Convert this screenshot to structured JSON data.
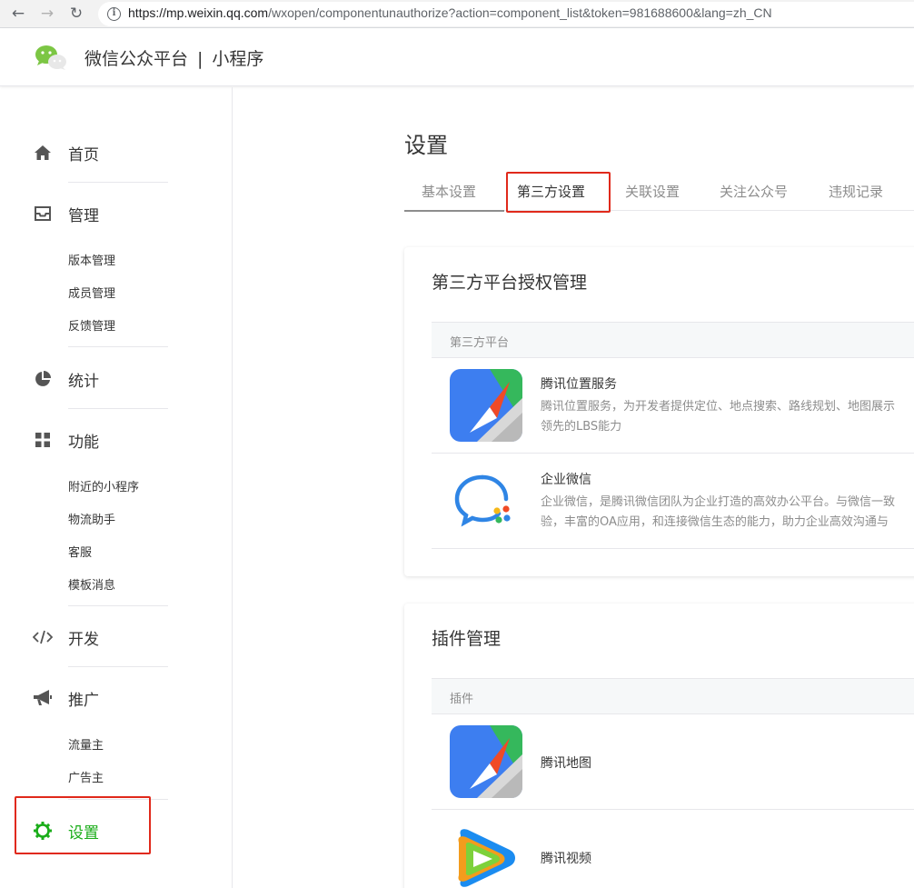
{
  "browser": {
    "url_host": "https://mp.weixin.qq.com",
    "url_rest": "/wxopen/componentunauthorize?action=component_list&token=981688600&lang=zh_CN"
  },
  "header": {
    "brand": "微信公众平台",
    "separator": "|",
    "product": "小程序"
  },
  "sidebar": {
    "home": "首页",
    "manage": "管理",
    "manage_items": [
      "版本管理",
      "成员管理",
      "反馈管理"
    ],
    "stats": "统计",
    "features": "功能",
    "feature_items": [
      "附近的小程序",
      "物流助手",
      "客服",
      "模板消息"
    ],
    "develop": "开发",
    "promote": "推广",
    "promote_items": [
      "流量主",
      "广告主"
    ],
    "settings": "设置"
  },
  "main": {
    "title": "设置",
    "tabs": [
      "基本设置",
      "第三方设置",
      "关联设置",
      "关注公众号",
      "违规记录"
    ],
    "active_tab": "第三方设置"
  },
  "third_party": {
    "title": "第三方平台授权管理",
    "column": "第三方平台",
    "rows": [
      {
        "name": "腾讯位置服务",
        "desc_line1": "腾讯位置服务，为开发者提供定位、地点搜索、路线规划、地图展示",
        "desc_line2": "领先的LBS能力"
      },
      {
        "name": "企业微信",
        "desc_line1": "企业微信，是腾讯微信团队为企业打造的高效办公平台。与微信一致",
        "desc_line2": "验，丰富的OA应用，和连接微信生态的能力，助力企业高效沟通与"
      }
    ]
  },
  "plugins": {
    "title": "插件管理",
    "column": "插件",
    "rows": [
      {
        "name": "腾讯地图"
      },
      {
        "name": "腾讯视频"
      }
    ]
  },
  "colors": {
    "accent": "#1aad19",
    "highlight_box": "#e0291b"
  }
}
